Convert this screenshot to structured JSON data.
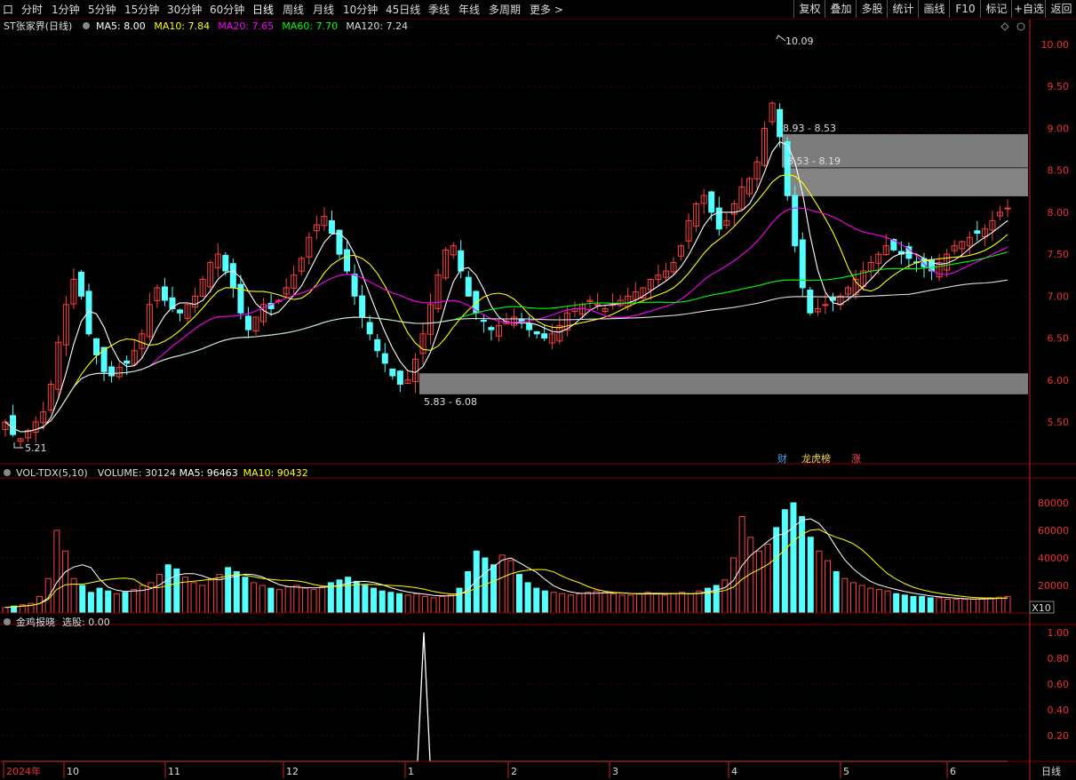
{
  "toolbar": {
    "periods": [
      "分时",
      "1分钟",
      "5分钟",
      "15分钟",
      "30分钟",
      "60分钟",
      "日线",
      "周线",
      "月线",
      "10分钟",
      "45日线",
      "季线",
      "年线",
      "多周期",
      "更多 >"
    ],
    "active": "日线",
    "right_buttons": [
      "复权",
      "叠加",
      "多股",
      "统计",
      "画线",
      "F10",
      "标记",
      "+自选",
      "返回"
    ],
    "left_box": "口"
  },
  "colors": {
    "up": "#ff4040",
    "down": "#54ffff",
    "ma5": "#ffffff",
    "ma10": "#ffff00",
    "ma20": "#ff00ff",
    "ma60": "#00ff00",
    "ma120": "#dddddd",
    "grid": "#400000",
    "axis": "#cc2222"
  },
  "main_chart": {
    "title": "ST张家界(日线)",
    "legend": [
      {
        "text": "MA5: 8.00",
        "color": "#ffffff"
      },
      {
        "text": "MA10: 7.84",
        "color": "#ffff00"
      },
      {
        "text": "MA20: 7.65",
        "color": "#ff00ff"
      },
      {
        "text": "MA60: 7.70",
        "color": "#00ff00"
      },
      {
        "text": "MA120: 7.24",
        "color": "#dddddd"
      }
    ],
    "y_ticks": [
      "10.00",
      "9.50",
      "9.00",
      "8.50",
      "8.00",
      "7.50",
      "7.00",
      "6.50",
      "6.00",
      "5.50"
    ],
    "annotations": {
      "high": "10.09",
      "low": "5.21",
      "zones": [
        "8.93 - 8.53",
        "8.53 - 8.19",
        "5.83 - 6.08"
      ]
    },
    "markers": [
      "财",
      "龙虎榜",
      "涨"
    ]
  },
  "volume_chart": {
    "legend": [
      {
        "text": "VOL-TDX(5,10)",
        "color": "#dddddd"
      },
      {
        "text": "VOLUME: 30124",
        "color": "#dddddd"
      },
      {
        "text": "MA5: 96463",
        "color": "#ffffff"
      },
      {
        "text": "MA10: 90432",
        "color": "#ffff00"
      }
    ],
    "y_ticks": [
      "80000",
      "60000",
      "40000",
      "20000"
    ],
    "unit": "X10"
  },
  "indicator_chart": {
    "legend": [
      {
        "text": "金鸡报晓",
        "color": "#dddddd"
      },
      {
        "text": "选股: 0.00",
        "color": "#dddddd"
      }
    ],
    "y_ticks": [
      "1.00",
      "0.80",
      "0.60",
      "0.40",
      "0.20"
    ]
  },
  "x_axis": {
    "labels": [
      "2024年",
      "10",
      "11",
      "12",
      "1",
      "2",
      "3",
      "4",
      "5",
      "6"
    ],
    "period_label": "日线"
  },
  "chart_data": {
    "type": "candlestick",
    "price_ylim": [
      5.2,
      10.15
    ],
    "volume_ylim": [
      0,
      100000
    ],
    "indicator_ylim": [
      0,
      1.05
    ],
    "zones": [
      {
        "label": "8.93 - 8.53",
        "low": 8.53,
        "high": 8.93
      },
      {
        "label": "8.53 - 8.19",
        "low": 8.19,
        "high": 8.53
      },
      {
        "label": "5.83 - 6.08",
        "low": 5.83,
        "high": 6.08
      }
    ],
    "signal_value": 1.0,
    "close_path": [
      5.5,
      5.35,
      5.3,
      5.4,
      5.5,
      5.62,
      5.95,
      6.45,
      6.9,
      7.2,
      7.0,
      6.55,
      6.3,
      6.1,
      6.05,
      6.15,
      6.2,
      6.35,
      6.55,
      6.9,
      7.1,
      6.95,
      6.85,
      6.8,
      6.9,
      7.0,
      7.2,
      7.4,
      7.5,
      7.3,
      7.1,
      6.8,
      6.6,
      6.75,
      6.9,
      6.85,
      6.95,
      7.1,
      7.25,
      7.45,
      7.7,
      7.85,
      7.95,
      7.75,
      7.5,
      7.3,
      7.0,
      6.75,
      6.55,
      6.35,
      6.2,
      6.05,
      5.95,
      6.0,
      6.25,
      6.55,
      6.9,
      7.25,
      7.55,
      7.6,
      7.3,
      7.0,
      6.8,
      6.7,
      6.6,
      6.65,
      6.7,
      6.75,
      6.7,
      6.6,
      6.55,
      6.5,
      6.55,
      6.65,
      6.8,
      6.85,
      6.9,
      6.95,
      6.9,
      6.85,
      6.9,
      6.95,
      7.0,
      7.05,
      7.1,
      7.2,
      7.25,
      7.3,
      7.4,
      7.6,
      7.9,
      8.1,
      8.2,
      8.0,
      7.8,
      7.9,
      8.1,
      8.3,
      8.4,
      8.6,
      9.0,
      9.3,
      8.9,
      8.2,
      7.6,
      7.1,
      6.8,
      6.85,
      6.9,
      6.95,
      7.0,
      7.1,
      7.2,
      7.3,
      7.4,
      7.5,
      7.6,
      7.55,
      7.5,
      7.45,
      7.4,
      7.35,
      7.3,
      7.4,
      7.5,
      7.6,
      7.65,
      7.7,
      7.75,
      7.8,
      7.9,
      8.0,
      8.05
    ],
    "volume_path": [
      4000,
      5000,
      6000,
      7000,
      12000,
      25000,
      60000,
      45000,
      25000,
      20000,
      15000,
      18000,
      16000,
      14000,
      15000,
      17000,
      20000,
      22000,
      28000,
      35000,
      32000,
      26000,
      22000,
      20000,
      24000,
      28000,
      33000,
      30000,
      26000,
      22000,
      20000,
      18000,
      17000,
      19000,
      20000,
      18000,
      17000,
      19000,
      22000,
      24000,
      26000,
      23000,
      20000,
      18000,
      16000,
      15000,
      14000,
      13000,
      14000,
      12000,
      11000,
      12000,
      13000,
      18000,
      30000,
      45000,
      40000,
      35000,
      42000,
      38000,
      28000,
      22000,
      18000,
      16000,
      15000,
      14000,
      13000,
      14000,
      15000,
      16000,
      15000,
      14000,
      13000,
      13000,
      14000,
      15000,
      14000,
      13000,
      14000,
      15000,
      14000,
      16000,
      18000,
      20000,
      24000,
      40000,
      70000,
      55000,
      45000,
      50000,
      62000,
      75000,
      80000,
      70000,
      55000,
      45000,
      38000,
      30000,
      25000,
      22000,
      20000,
      18000,
      17000,
      16000,
      14000,
      13000,
      12000,
      12000,
      11000,
      11000,
      10000,
      10000,
      10000,
      10000,
      10500,
      11000,
      11500,
      12000
    ]
  }
}
